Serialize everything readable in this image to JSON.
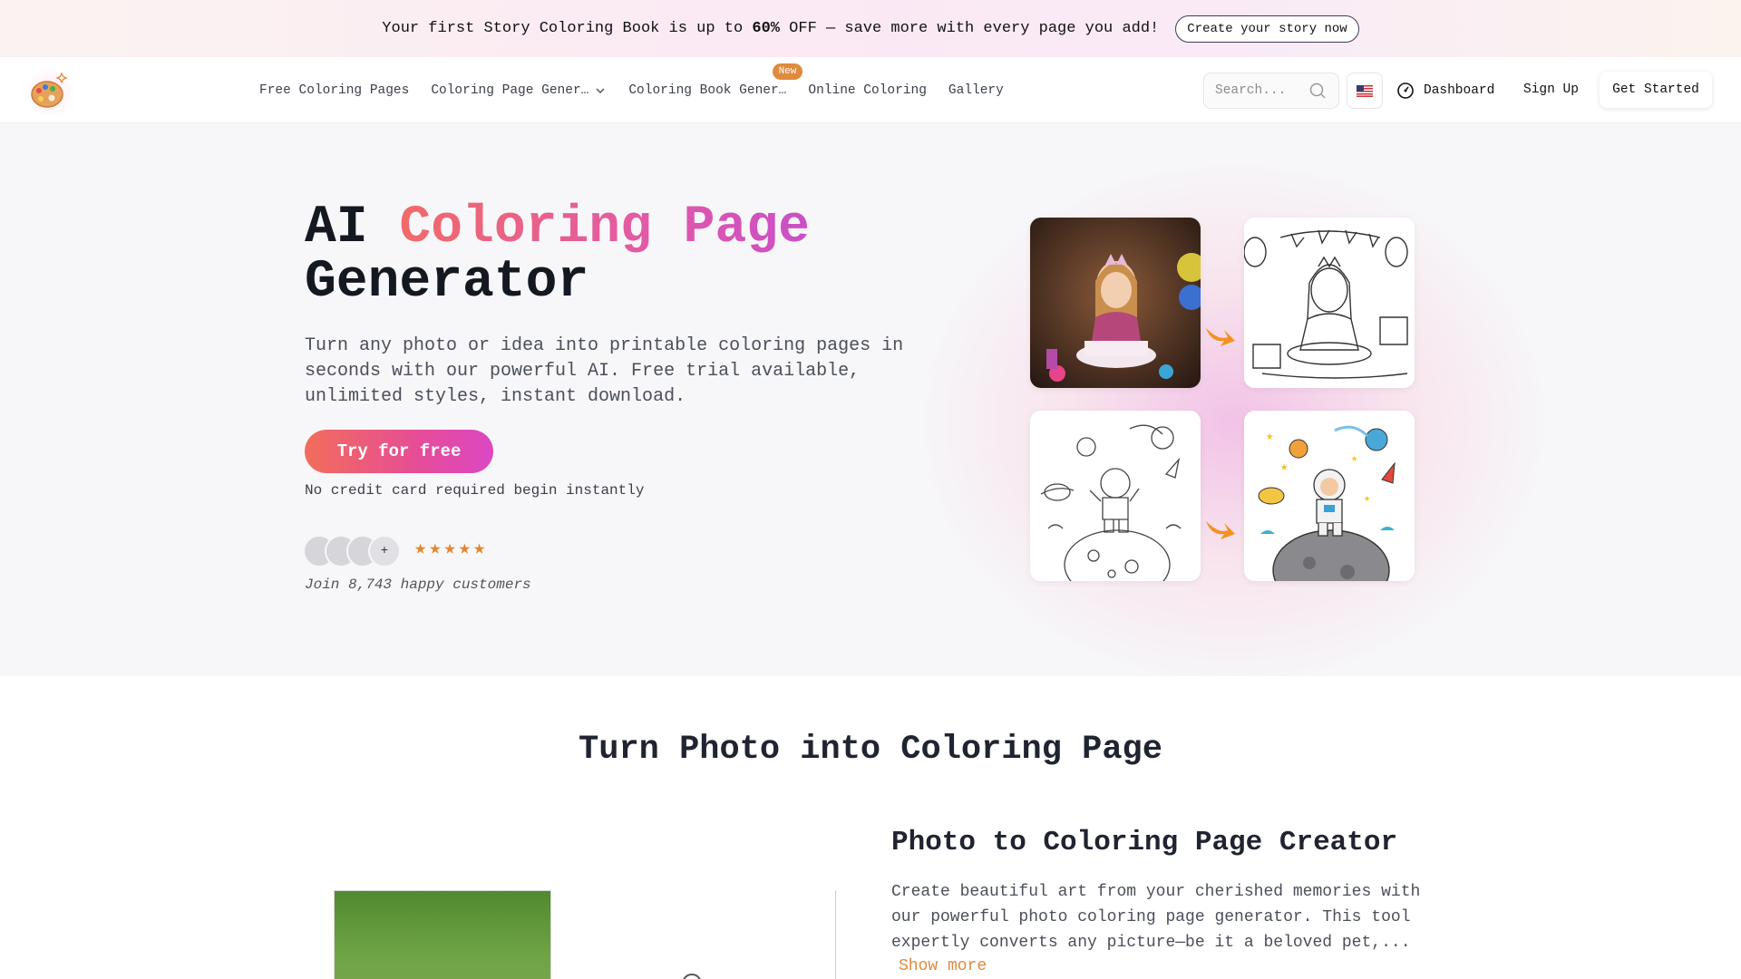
{
  "promo": {
    "text_before": "Your first Story Coloring Book is up to ",
    "text_bold": "60%",
    "text_after": " OFF — save more with every page you add!",
    "button": "Create your story now"
  },
  "nav": {
    "links": [
      {
        "label": "Free Coloring Pages"
      },
      {
        "label": "Coloring Page Gener…"
      },
      {
        "label": "Coloring Book Gener…",
        "badge": "New"
      },
      {
        "label": "Online Coloring"
      },
      {
        "label": "Gallery"
      }
    ],
    "search_placeholder": "Search...",
    "dashboard": "Dashboard",
    "sign_up": "Sign Up",
    "get_started": "Get Started"
  },
  "hero": {
    "title_plain_1": "AI ",
    "title_gradient": "Coloring Page",
    "title_plain_2": "Generator",
    "subtitle": "Turn any photo or idea into printable coloring pages in seconds with our powerful AI. Free trial available, unlimited styles, instant download.",
    "cta": "Try for free",
    "note": "No credit card required begin instantly",
    "avatar_more": "+",
    "rating_stars": 5,
    "join_text": "Join 8,743 happy customers"
  },
  "colors": {
    "accent_orange": "#e08a3c",
    "gradient_start": "#f26d5b",
    "gradient_end": "#db47c2"
  },
  "section2": {
    "title": "Turn Photo into Coloring Page",
    "feature_title": "Photo to Coloring Page Creator",
    "feature_text": "Create beautiful art from your cherished memories with our powerful photo coloring page generator. This tool expertly converts any picture—be it a beloved pet,...",
    "show_more": "Show more"
  }
}
